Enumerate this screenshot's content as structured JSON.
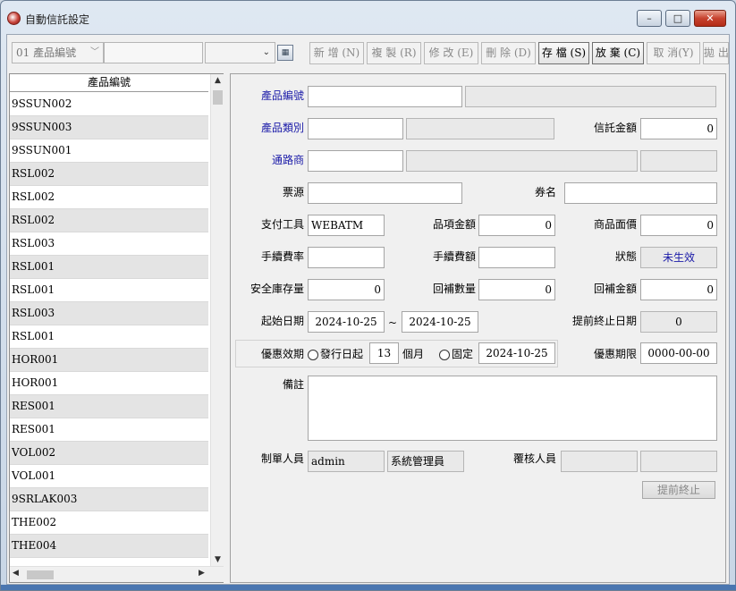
{
  "window": {
    "title": "自動信託設定",
    "minimize": "–",
    "maximize": "□",
    "close": "✕"
  },
  "toolbar": {
    "field_selector": "01 產品編號",
    "search_value": "",
    "select_value": "",
    "buttons": {
      "add": "新 增 (N)",
      "copy": "複 製 (R)",
      "edit": "修 改 (E)",
      "delete": "刪 除 (D)",
      "save": "存 檔 (S)",
      "discard": "放 棄 (C)",
      "cancel": "取 消(Y)",
      "throw": "拋 出"
    }
  },
  "list": {
    "header": "產品編號",
    "rows": [
      "9SSUN002",
      "9SSUN003",
      "9SSUN001",
      "RSL002",
      "RSL002",
      "RSL002",
      "RSL003",
      "RSL001",
      "RSL001",
      "RSL003",
      "RSL001",
      "HOR001",
      "HOR001",
      "RES001",
      "RES001",
      "VOL002",
      "VOL001",
      "9SRLAK003",
      "THE002",
      "THE004"
    ]
  },
  "form": {
    "product_code": {
      "label": "產品編號",
      "value": "",
      "name": ""
    },
    "product_type": {
      "label": "產品類別",
      "value": "",
      "name": ""
    },
    "trust_amount": {
      "label": "信託金額",
      "value": "0"
    },
    "channel": {
      "label": "通路商",
      "value": "",
      "name": "",
      "extra": ""
    },
    "ticket_source": {
      "label": "票源",
      "value": ""
    },
    "voucher_name": {
      "label": "券名",
      "value": ""
    },
    "payment_tool": {
      "label": "支付工具",
      "value": "WEBATM"
    },
    "item_amount": {
      "label": "品項金額",
      "value": "0"
    },
    "face_value": {
      "label": "商品面價",
      "value": "0"
    },
    "fee_rate": {
      "label": "手續費率",
      "value": ""
    },
    "fee_amount": {
      "label": "手續費額",
      "value": ""
    },
    "status": {
      "label": "狀態",
      "value": "未生效"
    },
    "safety_stock": {
      "label": "安全庫存量",
      "value": "0"
    },
    "refill_qty": {
      "label": "回補數量",
      "value": "0"
    },
    "refill_amount": {
      "label": "回補金額",
      "value": "0"
    },
    "start_date": {
      "label": "起始日期",
      "value": "2024-10-25",
      "tilde": "~"
    },
    "end_date": {
      "value": "2024-10-25"
    },
    "early_end_date": {
      "label": "提前終止日期",
      "value": "0"
    },
    "promo_period": {
      "label": "優惠效期",
      "option_issue": "發行日起",
      "months": "13",
      "months_unit": "個月",
      "option_fixed": "固定",
      "fixed_date": "2024-10-25"
    },
    "promo_deadline": {
      "label": "優惠期限",
      "value": "0000-00-00"
    },
    "notes": {
      "label": "備註",
      "value": ""
    },
    "creator": {
      "label": "制單人員",
      "id": "admin",
      "name": "系統管理員"
    },
    "reviewer": {
      "label": "覆核人員",
      "id": "",
      "name": ""
    },
    "early_end_button": "提前終止"
  }
}
